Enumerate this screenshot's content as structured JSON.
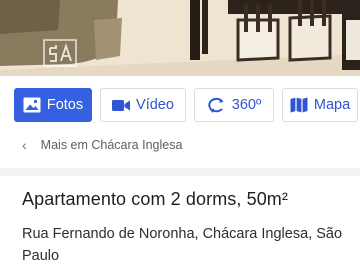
{
  "gallery": {
    "image_alt": "Sala de estar com sofá e mesa de jantar",
    "watermark": "5A"
  },
  "media_tabs": [
    {
      "label": "Fotos",
      "icon": "image-icon",
      "active": true
    },
    {
      "label": "Vídeo",
      "icon": "video-camera-icon",
      "active": false
    },
    {
      "label": "360º",
      "icon": "rotate-360-icon",
      "active": false
    },
    {
      "label": "Mapa",
      "icon": "map-icon",
      "active": false
    }
  ],
  "breadcrumb": {
    "back_icon": "chevron-left-icon",
    "label": "Mais em Chácara Inglesa"
  },
  "listing": {
    "title": "Apartamento com 2 dorms, 50m²",
    "address": "Rua Fernando de Noronha, Chácara Inglesa, São Paulo"
  },
  "colors": {
    "accent": "#3561e0",
    "tab_text": "#2f55d4",
    "divider": "#f1f2f4"
  }
}
